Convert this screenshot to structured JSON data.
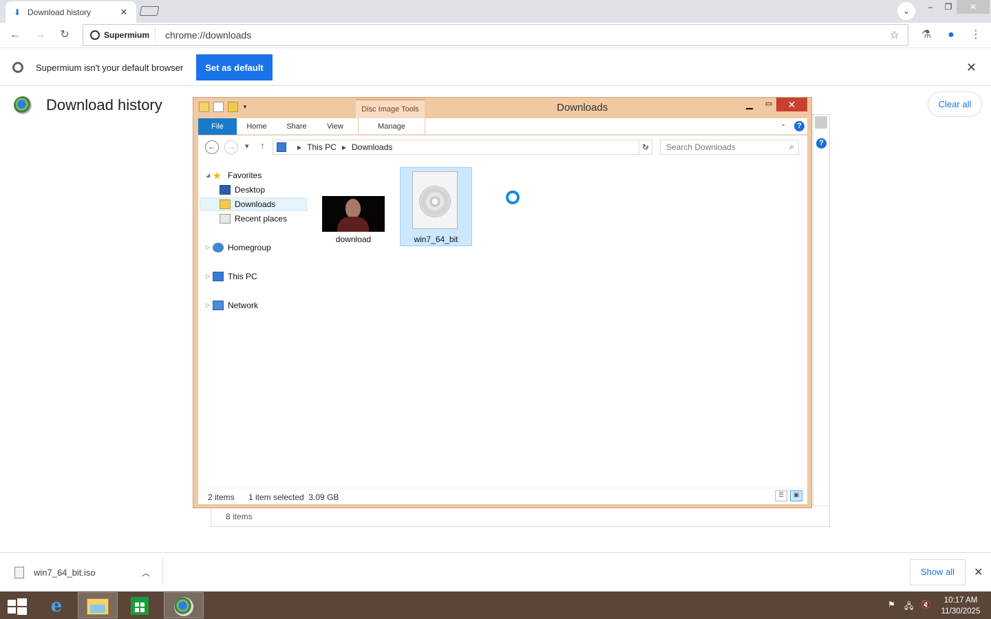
{
  "browser": {
    "tab": {
      "title": "Download history",
      "icon": "download-icon"
    },
    "omnibox": {
      "site_chip": "Supermium",
      "url": "chrome://downloads"
    },
    "infobar": {
      "message": "Supermium isn't your default browser",
      "button": "Set as default"
    }
  },
  "downloads_page": {
    "title": "Download history",
    "clear_all": "Clear all"
  },
  "background_window": {
    "status": "8 items"
  },
  "explorer": {
    "caption": "Downloads",
    "contextual_tab": "Disc Image Tools",
    "ribbon_tabs": [
      "File",
      "Home",
      "Share",
      "View",
      "Manage"
    ],
    "breadcrumb": [
      "This PC",
      "Downloads"
    ],
    "search_placeholder": "Search Downloads",
    "nav": {
      "favorites": "Favorites",
      "desktop": "Desktop",
      "downloads": "Downloads",
      "recent": "Recent places",
      "homegroup": "Homegroup",
      "thispc": "This PC",
      "network": "Network"
    },
    "files": [
      {
        "name": "download",
        "kind": "image"
      },
      {
        "name": "win7_64_bit",
        "kind": "disc-image",
        "selected": true
      }
    ],
    "status": {
      "items": "2 items",
      "selection": "1 item selected  3.09 GB"
    }
  },
  "download_shelf": {
    "filename": "win7_64_bit.iso",
    "show_all": "Show all"
  },
  "taskbar": {
    "clock_time": "10:17 AM",
    "clock_date": "11/30/2025"
  },
  "colors": {
    "accent": "#1a73e8",
    "explorer_frame": "#f0c9a3",
    "taskbar": "#5a4538",
    "file_tab": "#1979ca",
    "close_button": "#c74131"
  }
}
